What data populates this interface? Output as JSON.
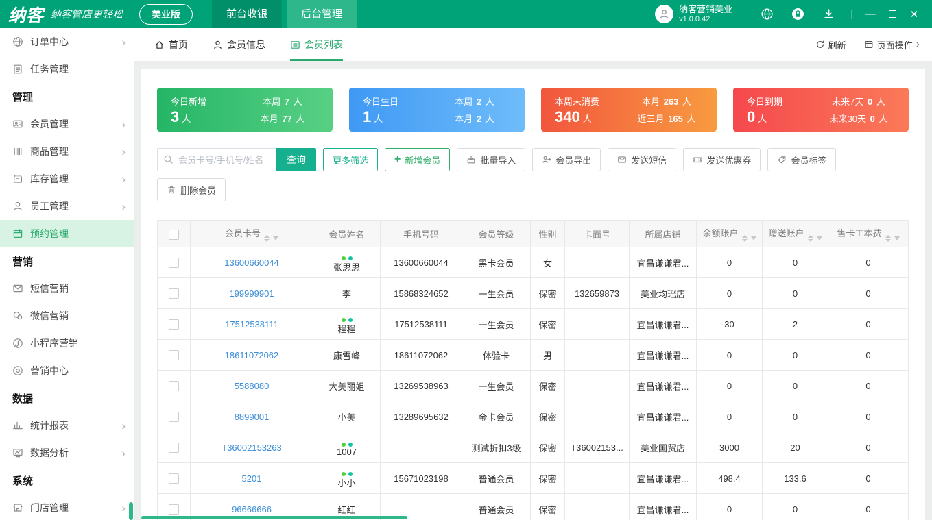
{
  "header": {
    "logo_text": "纳客",
    "slogan": "纳客管店更轻松",
    "edition_button": "美业版",
    "nav_tabs": [
      {
        "label": "前台收银"
      },
      {
        "label": "后台管理"
      }
    ],
    "account": {
      "name": "纳客营销美业",
      "version": "v1.0.0.42"
    },
    "window_controls": {
      "minimize": "—",
      "close": "✕"
    }
  },
  "sidebar": {
    "groups": [
      {
        "title": "",
        "items": [
          {
            "id": "order-center",
            "label": "订单中心",
            "icon": "globe",
            "arrow": true
          },
          {
            "id": "task",
            "label": "任务管理",
            "icon": "task",
            "arrow": false
          }
        ]
      },
      {
        "title": "管理",
        "items": [
          {
            "id": "member",
            "label": "会员管理",
            "icon": "member",
            "arrow": true
          },
          {
            "id": "product",
            "label": "商品管理",
            "icon": "product",
            "arrow": true
          },
          {
            "id": "inventory",
            "label": "库存管理",
            "icon": "inventory",
            "arrow": true
          },
          {
            "id": "staff",
            "label": "员工管理",
            "icon": "staff",
            "arrow": true
          },
          {
            "id": "appointment",
            "label": "预约管理",
            "icon": "calendar",
            "arrow": false,
            "active": true
          }
        ]
      },
      {
        "title": "营销",
        "items": [
          {
            "id": "sms-marketing",
            "label": "短信营销",
            "icon": "sms",
            "arrow": false
          },
          {
            "id": "wechat-marketing",
            "label": "微信营销",
            "icon": "wechat",
            "arrow": false
          },
          {
            "id": "miniprogram-marketing",
            "label": "小程序营销",
            "icon": "miniprogram",
            "arrow": false
          },
          {
            "id": "marketing-center",
            "label": "营销中心",
            "icon": "target",
            "arrow": false
          }
        ]
      },
      {
        "title": "数据",
        "items": [
          {
            "id": "report",
            "label": "统计报表",
            "icon": "report",
            "arrow": true
          },
          {
            "id": "analysis",
            "label": "数据分析",
            "icon": "analysis",
            "arrow": true
          }
        ]
      },
      {
        "title": "系统",
        "items": [
          {
            "id": "store",
            "label": "门店管理",
            "icon": "store",
            "arrow": true
          }
        ]
      }
    ]
  },
  "tabbar": {
    "tabs": [
      {
        "label": "首页"
      },
      {
        "label": "会员信息"
      },
      {
        "label": "会员列表",
        "active": true
      }
    ],
    "refresh_label": "刷新",
    "page_ops_label": "页面操作"
  },
  "stats_cards": [
    {
      "title": "今日新增",
      "value": "3",
      "unit": "人",
      "gradient": [
        "#25b566",
        "#58d084"
      ],
      "rows": [
        {
          "label": "本周",
          "value": "7",
          "unit": "人"
        },
        {
          "label": "本月",
          "value": "77",
          "unit": "人"
        }
      ]
    },
    {
      "title": "今日生日",
      "value": "1",
      "unit": "人",
      "gradient": [
        "#3f99f4",
        "#6fbcfa"
      ],
      "rows": [
        {
          "label": "本周",
          "value": "2",
          "unit": "人"
        },
        {
          "label": "本月",
          "value": "2",
          "unit": "人"
        }
      ]
    },
    {
      "title": "本周未消费",
      "value": "340",
      "unit": "人",
      "gradient": [
        "#f2563e",
        "#f89b40"
      ],
      "rows": [
        {
          "label": "本月",
          "value": "263",
          "unit": "人"
        },
        {
          "label": "近三月",
          "value": "165",
          "unit": "人"
        }
      ]
    },
    {
      "title": "今日到期",
      "value": "0",
      "unit": "人",
      "gradient": [
        "#f5484d",
        "#fa7a58"
      ],
      "rows": [
        {
          "label": "未来7天",
          "value": "0",
          "unit": "人"
        },
        {
          "label": "未来30天",
          "value": "0",
          "unit": "人"
        }
      ]
    }
  ],
  "toolbar": {
    "search_placeholder": "会员卡号/手机号/姓名",
    "search_button": "查询",
    "more_filter": "更多筛选",
    "add_member": "新增会员",
    "batch_import": "批量导入",
    "export_member": "会员导出",
    "send_sms": "发送短信",
    "send_coupon": "发送优惠券",
    "member_tag": "会员标签",
    "delete_member": "删除会员"
  },
  "table": {
    "columns": [
      "",
      "会员卡号",
      "会员姓名",
      "手机号码",
      "会员等级",
      "性别",
      "卡面号",
      "所属店铺",
      "余额账户",
      "赠送账户",
      "售卡工本费"
    ],
    "sortable": [
      false,
      true,
      false,
      false,
      false,
      false,
      false,
      false,
      true,
      true,
      true
    ],
    "rows": [
      {
        "card_no": "13600660044",
        "name": "张思思",
        "tags": true,
        "phone": "13600660044",
        "level": "黑卡会员",
        "gender": "女",
        "card_face": "",
        "store": "宜昌谦谦君...",
        "balance": "0",
        "gift": "0",
        "fee": "0"
      },
      {
        "card_no": "199999901",
        "name": "李",
        "tags": false,
        "phone": "15868324652",
        "level": "一生会员",
        "gender": "保密",
        "card_face": "132659873",
        "store": "美业均瑶店",
        "balance": "0",
        "gift": "0",
        "fee": "0"
      },
      {
        "card_no": "17512538111",
        "name": "程程",
        "tags": true,
        "phone": "17512538111",
        "level": "一生会员",
        "gender": "保密",
        "card_face": "",
        "store": "宜昌谦谦君...",
        "balance": "30",
        "gift": "2",
        "fee": "0"
      },
      {
        "card_no": "18611072062",
        "name": "康雪峰",
        "tags": false,
        "phone": "18611072062",
        "level": "体验卡",
        "gender": "男",
        "card_face": "",
        "store": "宜昌谦谦君...",
        "balance": "0",
        "gift": "0",
        "fee": "0"
      },
      {
        "card_no": "5588080",
        "name": "大美丽姐",
        "tags": false,
        "phone": "13269538963",
        "level": "一生会员",
        "gender": "保密",
        "card_face": "",
        "store": "宜昌谦谦君...",
        "balance": "0",
        "gift": "0",
        "fee": "0"
      },
      {
        "card_no": "8899001",
        "name": "小美",
        "tags": false,
        "phone": "13289695632",
        "level": "金卡会员",
        "gender": "保密",
        "card_face": "",
        "store": "宜昌谦谦君...",
        "balance": "0",
        "gift": "0",
        "fee": "0"
      },
      {
        "card_no": "T36002153263",
        "name": "1007",
        "tags": true,
        "phone": "",
        "level": "测试折扣3级",
        "gender": "保密",
        "card_face": "T36002153...",
        "store": "美业国贸店",
        "balance": "3000",
        "gift": "20",
        "fee": "0"
      },
      {
        "card_no": "5201",
        "name": "小小",
        "tags": true,
        "phone": "15671023198",
        "level": "普通会员",
        "gender": "保密",
        "card_face": "",
        "store": "宜昌谦谦君...",
        "balance": "498.4",
        "gift": "133.6",
        "fee": "0"
      },
      {
        "card_no": "96666666",
        "name": "红红",
        "tags": false,
        "phone": "",
        "level": "普通会员",
        "gender": "保密",
        "card_face": "",
        "store": "宜昌谦谦君...",
        "balance": "0",
        "gift": "0",
        "fee": "0"
      }
    ]
  }
}
